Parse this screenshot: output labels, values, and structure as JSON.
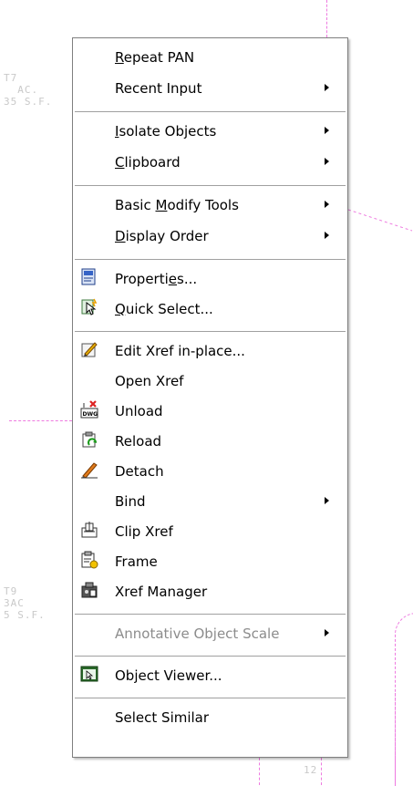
{
  "background": {
    "labels": [
      {
        "text": "T7\n  AC.\n35 S.F."
      },
      {
        "text": "T9\n3AC\n5 S.F."
      },
      {
        "text": "12"
      }
    ]
  },
  "menu": {
    "groups": [
      [
        {
          "id": "repeat-pan",
          "pre": "",
          "acc": "R",
          "post": "epeat PAN",
          "submenu": false,
          "icon": null
        },
        {
          "id": "recent-input",
          "pre": "Recent Input",
          "acc": "",
          "post": "",
          "submenu": true,
          "icon": null
        }
      ],
      [
        {
          "id": "isolate-objects",
          "pre": "",
          "acc": "I",
          "post": "solate Objects",
          "submenu": true,
          "icon": null
        },
        {
          "id": "clipboard",
          "pre": "",
          "acc": "C",
          "post": "lipboard",
          "submenu": true,
          "icon": null
        }
      ],
      [
        {
          "id": "basic-modify-tools",
          "pre": "Basic ",
          "acc": "M",
          "post": "odify Tools",
          "submenu": true,
          "icon": null
        },
        {
          "id": "display-order",
          "pre": "",
          "acc": "D",
          "post": "isplay Order",
          "submenu": true,
          "icon": null
        }
      ],
      [
        {
          "id": "properties",
          "pre": "Properti",
          "acc": "e",
          "post": "s...",
          "submenu": false,
          "icon": "properties-icon"
        },
        {
          "id": "quick-select",
          "pre": "",
          "acc": "Q",
          "post": "uick Select...",
          "submenu": false,
          "icon": "quick-select-icon"
        }
      ],
      [
        {
          "id": "edit-xref-in-place",
          "pre": "Edit Xref in-place...",
          "acc": "",
          "post": "",
          "submenu": false,
          "icon": "edit-xref-icon"
        },
        {
          "id": "open-xref",
          "pre": "Open Xref",
          "acc": "",
          "post": "",
          "submenu": false,
          "icon": null
        },
        {
          "id": "unload",
          "pre": "Unload",
          "acc": "",
          "post": "",
          "submenu": false,
          "icon": "unload-icon"
        },
        {
          "id": "reload",
          "pre": "Reload",
          "acc": "",
          "post": "",
          "submenu": false,
          "icon": "reload-icon"
        },
        {
          "id": "detach",
          "pre": "Detach",
          "acc": "",
          "post": "",
          "submenu": false,
          "icon": "detach-icon"
        },
        {
          "id": "bind",
          "pre": "Bind",
          "acc": "",
          "post": "",
          "submenu": true,
          "icon": null
        },
        {
          "id": "clip-xref",
          "pre": "Clip Xref",
          "acc": "",
          "post": "",
          "submenu": false,
          "icon": "clip-xref-icon"
        },
        {
          "id": "frame",
          "pre": "Frame",
          "acc": "",
          "post": "",
          "submenu": false,
          "icon": "frame-icon"
        },
        {
          "id": "xref-manager",
          "pre": "Xref Manager",
          "acc": "",
          "post": "",
          "submenu": false,
          "icon": "xref-manager-icon"
        }
      ],
      [
        {
          "id": "annotative-object-scale",
          "pre": "Annotative Object Scale",
          "acc": "",
          "post": "",
          "submenu": true,
          "disabled": true,
          "icon": null
        }
      ],
      [
        {
          "id": "object-viewer",
          "pre": "Object Viewer...",
          "acc": "",
          "post": "",
          "submenu": false,
          "icon": "object-viewer-icon"
        }
      ],
      [
        {
          "id": "select-similar",
          "pre": "Select Similar",
          "acc": "",
          "post": "",
          "submenu": false,
          "icon": null
        }
      ]
    ]
  }
}
